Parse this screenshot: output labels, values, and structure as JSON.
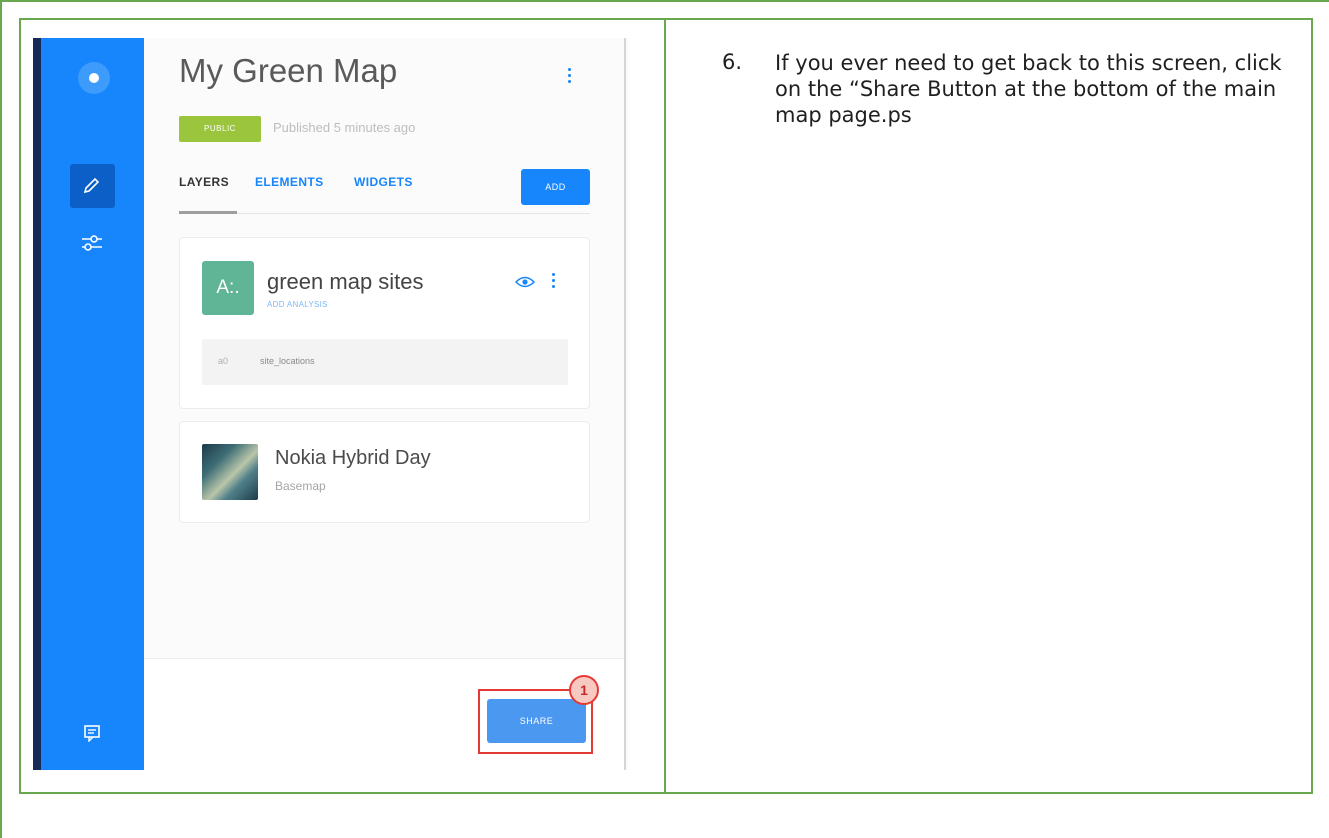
{
  "screenshot": {
    "map_title": "My Green Map",
    "badge": "PUBLIC",
    "published": "Published 5 minutes ago",
    "tabs": [
      "LAYERS",
      "ELEMENTS",
      "WIDGETS"
    ],
    "add_label": "ADD",
    "layer": {
      "thumb": "A:.",
      "name": "green map sites",
      "sub": "ADD ANALYSIS",
      "source_icon": "a0",
      "source": "site_locations"
    },
    "basemap": {
      "name": "Nokia Hybrid Day",
      "sub": "Basemap"
    },
    "share_label": "SHARE",
    "step_marker": "1"
  },
  "instruction": {
    "number": "6.",
    "text": "If you ever need to get back to this screen, click on the “Share Button at the bottom of the main map page.ps"
  },
  "colors": {
    "sidebar": "#1785fb",
    "accent": "#1785fb",
    "public_badge": "#9bc53d",
    "highlight": "#e53935",
    "table_border": "#6aa84f"
  }
}
